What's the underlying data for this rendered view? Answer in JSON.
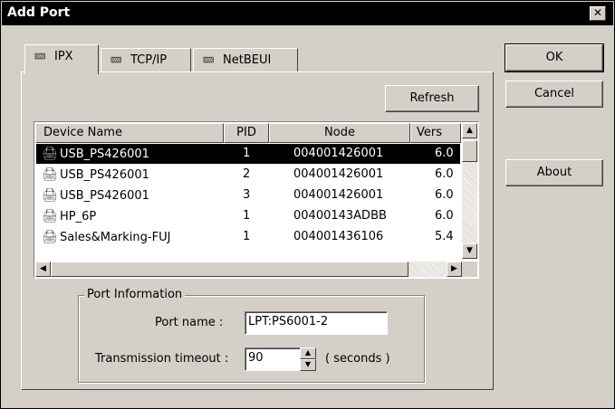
{
  "window": {
    "title": "Add Port",
    "close_glyph": "✕"
  },
  "tabs": [
    {
      "label": "IPX",
      "icon": "network-cable-icon",
      "active": true
    },
    {
      "label": "TCP/IP",
      "icon": "network-cable-icon",
      "active": false
    },
    {
      "label": "NetBEUI",
      "icon": "network-cable-icon",
      "active": false
    }
  ],
  "buttons": {
    "ok": "OK",
    "cancel": "Cancel",
    "about": "About",
    "refresh": "Refresh"
  },
  "device_list": {
    "columns": [
      "Device Name",
      "PID",
      "Node",
      "Vers"
    ],
    "rows": [
      {
        "name": "USB_PS426001",
        "pid": "1",
        "node": "004001426001",
        "version": "6.0",
        "selected": true
      },
      {
        "name": "USB_PS426001",
        "pid": "2",
        "node": "004001426001",
        "version": "6.0",
        "selected": false
      },
      {
        "name": "USB_PS426001",
        "pid": "3",
        "node": "004001426001",
        "version": "6.0",
        "selected": false
      },
      {
        "name": "HP_6P",
        "pid": "1",
        "node": "00400143ADBB",
        "version": "6.0",
        "selected": false
      },
      {
        "name": "Sales&Marking-FUJ",
        "pid": "1",
        "node": "004001436106",
        "version": "5.4",
        "selected": false
      }
    ]
  },
  "port_info": {
    "group_title": "Port Information",
    "port_name_label": "Port name :",
    "port_name_value": "LPT:PS6001-2",
    "timeout_label": "Transmission timeout :",
    "timeout_value": "90",
    "timeout_unit": "( seconds )"
  }
}
